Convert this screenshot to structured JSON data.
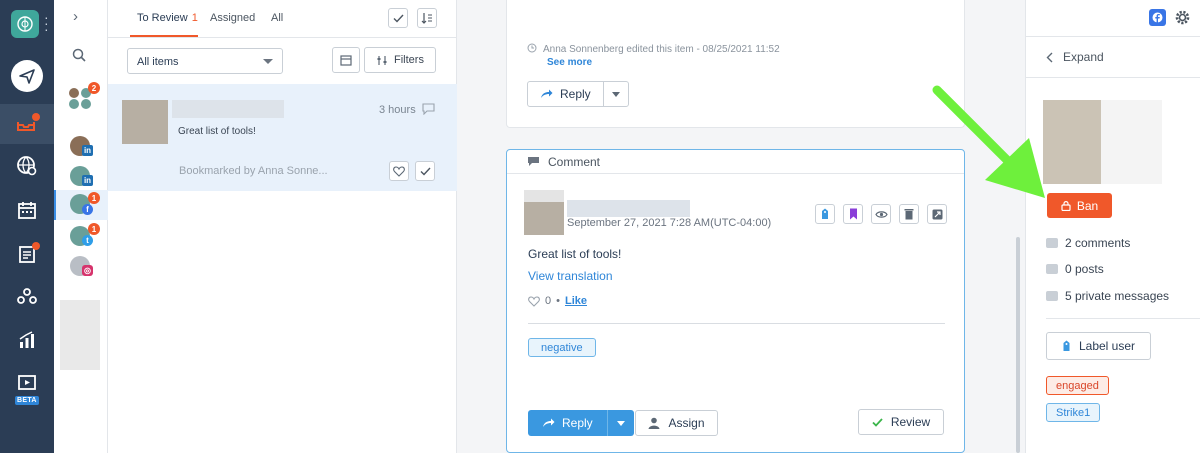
{
  "nav": {
    "items": [
      "logo-icon",
      "compose-icon",
      "inbox-icon",
      "listening-icon",
      "calendar-icon",
      "tasks-icon",
      "people-icon",
      "reports-icon",
      "videos-icon"
    ],
    "beta_label": "BETA"
  },
  "profiles": {
    "group_count": "2",
    "facebook_count": "1",
    "twitter_count": "1"
  },
  "inbox": {
    "tabs": [
      {
        "label": "To Review",
        "count": "1"
      },
      {
        "label": "Assigned"
      },
      {
        "label": "All"
      }
    ],
    "filter_select": "All items",
    "filters_label": "Filters",
    "item": {
      "time": "3 hours",
      "text": "Great list of tools!",
      "bookmarked": "Bookmarked by Anna Sonne..."
    }
  },
  "conversation": {
    "edit_note": "Anna Sonnenberg edited this item - 08/25/2021 11:52",
    "see_more": "See more",
    "reply_label": "Reply",
    "comment_header": "Comment",
    "comment_date": "September 27, 2021 7:28 AM(UTC-04:00)",
    "comment_text": "Great list of tools!",
    "view_translation": "View translation",
    "like_count": "0",
    "like_separator": "•",
    "like_label": "Like",
    "tag": "negative",
    "assign_label": "Assign",
    "review_label": "Review"
  },
  "right_panel": {
    "expand_label": "Expand",
    "ban_label": "Ban",
    "stats": [
      "2 comments",
      "0 posts",
      "5 private messages"
    ],
    "label_user": "Label user",
    "tags": [
      "engaged",
      "Strike1"
    ]
  },
  "colors": {
    "nav_bg": "#2b3d55",
    "accent_orange": "#f0582a",
    "accent_blue": "#3a98e0",
    "annotation_arrow": "#6ef03c"
  }
}
